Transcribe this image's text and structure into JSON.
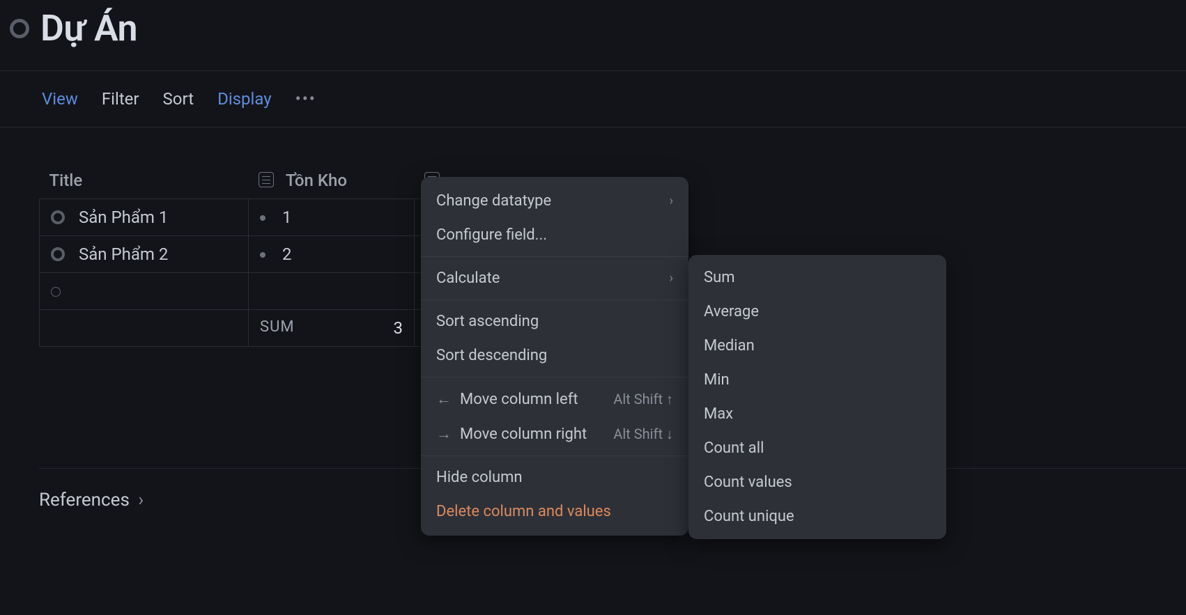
{
  "header": {
    "title": "Dự Án"
  },
  "toolbar": {
    "view": "View",
    "filter": "Filter",
    "sort": "Sort",
    "display": "Display"
  },
  "table": {
    "columns": {
      "title": "Title",
      "stock": "Tồn Kho"
    },
    "rows": [
      {
        "title": "Sản Phẩm 1",
        "stock": "1"
      },
      {
        "title": "Sản Phẩm 2",
        "stock": "2"
      }
    ],
    "summary": {
      "label": "SUM",
      "value": "3"
    }
  },
  "references": {
    "label": "References"
  },
  "context_menu": {
    "change_datatype": "Change datatype",
    "configure_field": "Configure field...",
    "calculate": "Calculate",
    "sort_asc": "Sort ascending",
    "sort_desc": "Sort descending",
    "move_left": "Move column left",
    "move_left_shortcut": "Alt Shift ↑",
    "move_right": "Move column right",
    "move_right_shortcut": "Alt Shift ↓",
    "hide": "Hide column",
    "delete": "Delete column and values"
  },
  "calculate_submenu": {
    "sum": "Sum",
    "average": "Average",
    "median": "Median",
    "min": "Min",
    "max": "Max",
    "count_all": "Count all",
    "count_values": "Count values",
    "count_unique": "Count unique"
  }
}
